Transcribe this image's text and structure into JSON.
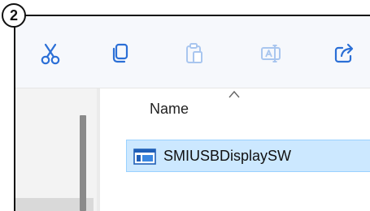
{
  "callout": {
    "number": "2"
  },
  "toolbar": {
    "buttons": [
      {
        "icon": "cut-icon",
        "label": "Cut",
        "enabled": true
      },
      {
        "icon": "copy-icon",
        "label": "Copy",
        "enabled": true
      },
      {
        "icon": "paste-icon",
        "label": "Paste",
        "enabled": false
      },
      {
        "icon": "rename-icon",
        "label": "Rename",
        "enabled": false
      },
      {
        "icon": "share-icon",
        "label": "Share",
        "enabled": true
      }
    ],
    "colors": {
      "cut": "#2b6fd6",
      "copy": "#2b6fd6",
      "disabled": "#a9c6ef",
      "share": "#2b6fd6"
    }
  },
  "file_list": {
    "columns": [
      {
        "label": "Name",
        "sort": "ascending"
      }
    ],
    "rows": [
      {
        "name": "SMIUSBDisplaySW",
        "icon": "application-icon",
        "selected": true
      }
    ],
    "selection_color": "#cce8ff"
  }
}
